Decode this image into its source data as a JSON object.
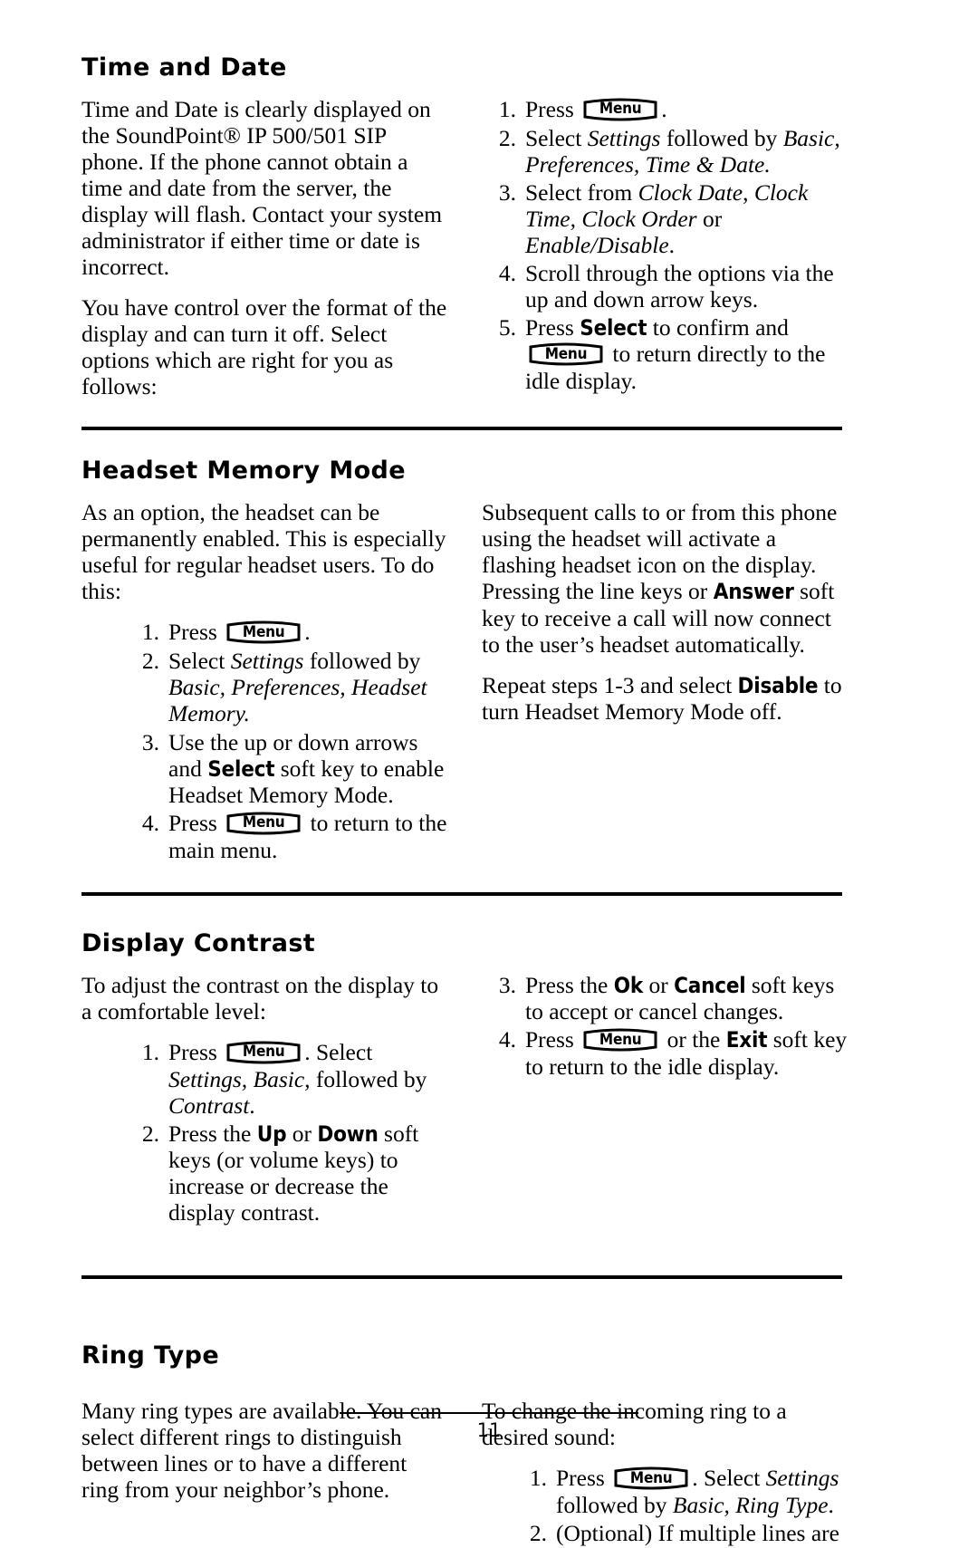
{
  "document": {
    "page_number": "11"
  },
  "menu_key": {
    "label": "Menu"
  },
  "sections": [
    {
      "id": "time-and-date",
      "title": "Time and Date",
      "left_paragraphs": [
        "Time and Date is clearly displayed on the SoundPoint® IP 500/501 SIP phone.  If the phone cannot obtain a time and date from the server, the display will flash.  Contact your system administrator if either time or date is incorrect.",
        "You have control over the format of the display and can turn it off.  Select options which are right for you as follows:"
      ],
      "steps": [
        {
          "num": "1.",
          "text_before": "Press ",
          "key": "Menu",
          "text_after": "."
        },
        {
          "num": "2.",
          "text_before": "Select ",
          "italic1": "Settings",
          "mid": " followed by ",
          "italic2": "Basic, Preferences, Time & Date."
        },
        {
          "num": "3.",
          "text_before": "Select from ",
          "italic1": "Clock Date",
          "mid": ", ",
          "italic2": "Clock Time, Clock Order",
          "mid2": " or ",
          "italic3": "Enable/Disable",
          "tail": "."
        },
        {
          "num": "4.",
          "text_before": "Scroll through the options via the up and down arrow keys."
        },
        {
          "num": "5.",
          "text_before": "Press ",
          "softkey": "Select",
          "mid": " to confirm and ",
          "key": "Menu",
          "text_after": " to return directly to the idle display."
        }
      ]
    },
    {
      "id": "headset-memory-mode",
      "title": "Headset Memory Mode",
      "left_intro": "As an option, the headset can be permanently enabled.  This is especially useful for regular headset users.  To do this:",
      "steps": [
        {
          "num": "1.",
          "text_before": "Press ",
          "key": "Menu",
          "text_after": "."
        },
        {
          "num": "2.",
          "text_before": "Select ",
          "italic1": "Settings",
          "mid": " followed by ",
          "italic2": "Basic, Preferences, Headset Memory."
        },
        {
          "num": "3.",
          "text_before": "Use the up or down arrows and ",
          "softkey": "Select",
          "mid": " soft key to enable Headset Memory Mode."
        },
        {
          "num": "4.",
          "text_before": "Press ",
          "key": "Menu",
          "text_after": " to return to the main menu."
        }
      ],
      "right_paragraphs": [
        "Subsequent calls to or from this phone using the headset will activate a flashing headset icon on the display.  Pressing the line keys or ",
        "Repeat steps 1-3 and select "
      ],
      "right_softkey_1": "Answer",
      "right_p1_tail": " soft key to receive a call will now connect to the user’s headset automatically.",
      "right_softkey_2": "Disable",
      "right_p2_tail": " to turn Headset Memory Mode off."
    },
    {
      "id": "display-contrast",
      "title": "Display Contrast",
      "left_intro": "To adjust the contrast on the display to a comfortable level:",
      "steps": [
        {
          "num": "1.",
          "text_before": "Press ",
          "key": "Menu",
          "mid": ".  Select ",
          "italic1": "Settings, Basic,",
          "mid2": " followed by ",
          "italic2": "Contrast",
          "tail": "."
        },
        {
          "num": "2.",
          "text_before": "Press the ",
          "softkey1": "Up",
          "mid": " or ",
          "softkey2": "Down",
          "tail": " soft keys (or volume keys) to increase or decrease the display contrast."
        }
      ],
      "right_steps": [
        {
          "num": "3.",
          "text_before": "Press the ",
          "softkey1": "Ok",
          "mid": " or ",
          "softkey2": "Cancel",
          "tail": " soft keys to accept or cancel changes."
        },
        {
          "num": "4.",
          "text_before": "Press ",
          "key": "Menu",
          "mid": " or the ",
          "softkey1": "Exit",
          "tail": " soft key to return to the idle display."
        }
      ]
    },
    {
      "id": "ring-type",
      "title": "Ring Type",
      "left_paragraph": "Many ring types are available.  You can select different rings to distinguish between lines or to have a different ring from your neighbor’s phone.",
      "right_intro": "To change the incoming ring to a desired sound:",
      "right_steps": [
        {
          "num": "1.",
          "text_before": "Press ",
          "key": "Menu",
          "mid": ".  Select ",
          "italic1": "Settings",
          "mid2": " followed by ",
          "italic2": "Basic, Ring Type",
          "tail": "."
        },
        {
          "num": "2.",
          "text_before": "(Optional)  If multiple lines are"
        }
      ]
    }
  ]
}
